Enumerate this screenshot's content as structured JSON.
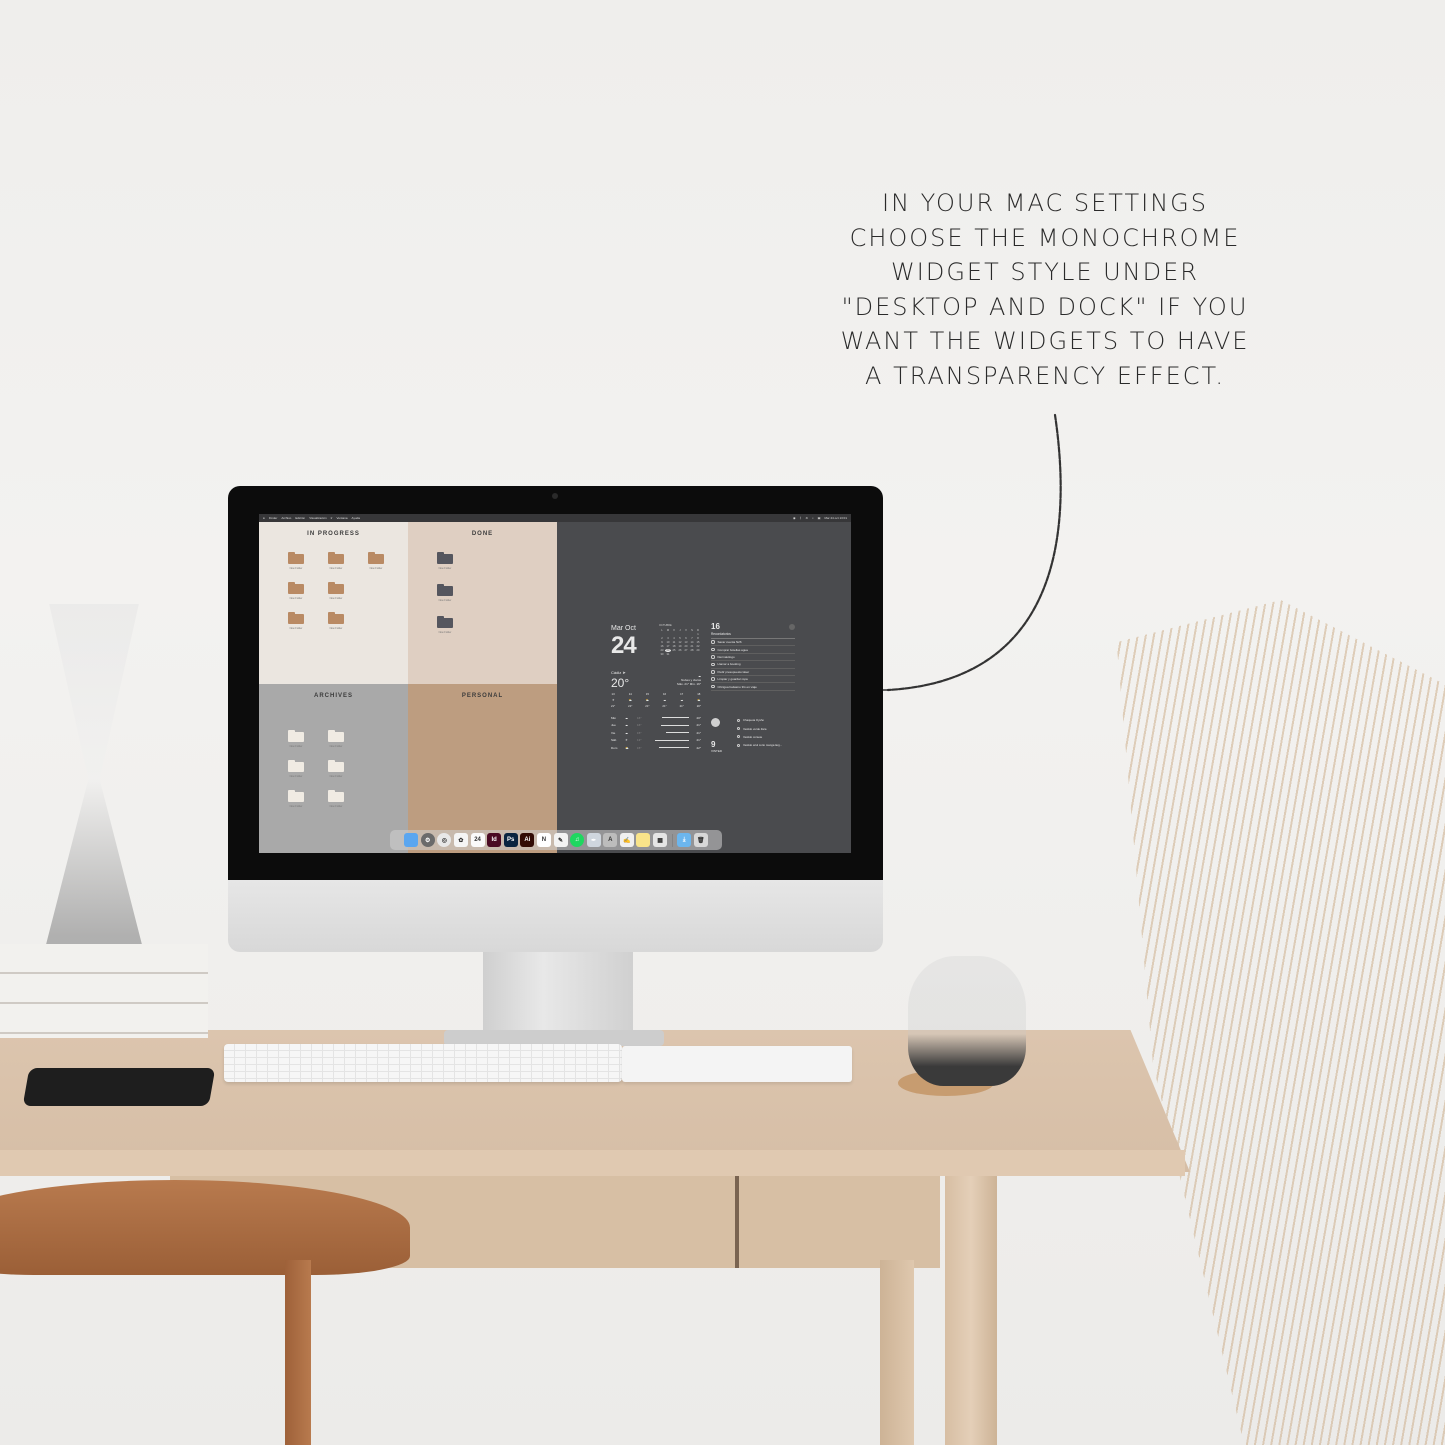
{
  "annotation": {
    "lines": [
      "In your Mac settings",
      "choose the monochrome",
      "widget style under",
      "\"Desktop and Dock\" if you",
      "want the widgets to have",
      "a transparency effect."
    ]
  },
  "menubar": {
    "left_items": [
      "Finder",
      "Archivo",
      "Edición",
      "Visualización",
      "Ir",
      "Ventana",
      "Ayuda"
    ],
    "datetime": "Mar 24 oct 13:01"
  },
  "desktop": {
    "quadrants": [
      {
        "title": "IN PROGRESS",
        "folder_style": "tan",
        "folders": [
          "New Folder",
          "New Folder",
          "New Folder",
          "New Folder",
          "New Folder",
          "New Folder",
          "New Folder"
        ]
      },
      {
        "title": "DONE",
        "folder_style": "dark",
        "folders": [
          "New Folder",
          "New Folder",
          "New Folder"
        ]
      },
      {
        "title": "ARCHIVES",
        "folder_style": "cream",
        "folders": [
          "New Folder",
          "New Folder",
          "New Folder",
          "New Folder",
          "New Folder",
          "New Folder"
        ]
      },
      {
        "title": "PERSONAL",
        "folder_style": "none",
        "folders": []
      }
    ]
  },
  "widgets": {
    "date": {
      "weekday_month": "Mar Oct",
      "day": "24"
    },
    "calendar": {
      "month": "OCTUBRE",
      "weekday_headers": [
        "L",
        "M",
        "X",
        "J",
        "V",
        "S",
        "D"
      ],
      "days": [
        "",
        "",
        "",
        "",
        "",
        "",
        "1",
        "2",
        "3",
        "4",
        "5",
        "6",
        "7",
        "8",
        "9",
        "10",
        "11",
        "12",
        "13",
        "14",
        "15",
        "16",
        "17",
        "18",
        "19",
        "20",
        "21",
        "22",
        "23",
        "24",
        "25",
        "26",
        "27",
        "28",
        "29",
        "30",
        "31"
      ],
      "today": "24"
    },
    "weather": {
      "location": "Cádiz",
      "temp": "20°",
      "condition": "Nubes y claros",
      "hi_lo": "Máx. 21° Mín. 16°",
      "hourly": [
        {
          "hour": "13",
          "icon": "sun-icon",
          "temp": "21°"
        },
        {
          "hour": "14",
          "icon": "partly-cloudy-icon",
          "temp": "21°"
        },
        {
          "hour": "15",
          "icon": "partly-cloudy-icon",
          "temp": "21°"
        },
        {
          "hour": "16",
          "icon": "cloud-icon",
          "temp": "21°"
        },
        {
          "hour": "17",
          "icon": "cloud-icon",
          "temp": "21°"
        },
        {
          "hour": "18",
          "icon": "partly-cloudy-icon",
          "temp": "20°"
        }
      ],
      "daily": [
        {
          "day": "Mié",
          "icon": "cloud-icon",
          "low": "16°",
          "high": "20°",
          "range_pct": 70
        },
        {
          "day": "Jue",
          "icon": "cloud-icon",
          "low": "16°",
          "high": "21°",
          "range_pct": 75
        },
        {
          "day": "Vie",
          "icon": "cloud-icon",
          "low": "15°",
          "high": "21°",
          "range_pct": 60
        },
        {
          "day": "Sáb",
          "icon": "sun-icon",
          "low": "13°",
          "high": "21°",
          "range_pct": 90
        },
        {
          "day": "Dom",
          "icon": "partly-cloudy-icon",
          "low": "15°",
          "high": "22°",
          "range_pct": 80
        }
      ]
    },
    "reminders": {
      "count": "16",
      "title": "Recordatorios",
      "items": [
        "Sacar cuenta N26",
        "Comprar botellas agua",
        "Dermatólogo",
        "Llamar a booking",
        "Pedir presupuesto láser",
        "Limpiar y guardar ropa",
        "Chirigua balsamo 3G en viaje"
      ]
    },
    "shopping": {
      "count": "9",
      "label": "VINTED",
      "items": [
        "Chaqueta Oysho",
        "Vestido verde Zara",
        "Vestido corsete",
        "Vestido azul corto manga larg..."
      ]
    }
  },
  "dock": {
    "apps": [
      {
        "name": "finder",
        "label": "",
        "color": "#5aa6f0"
      },
      {
        "name": "system-settings",
        "label": "⚙",
        "color": "#6b6b6b"
      },
      {
        "name": "chrome",
        "label": "◎",
        "color": "#e8e8e8"
      },
      {
        "name": "photos",
        "label": "✿",
        "color": "#f5f5f5"
      },
      {
        "name": "calendar",
        "label": "24",
        "color": "#fafafa"
      },
      {
        "name": "indesign",
        "label": "Id",
        "color": "#4a0a23"
      },
      {
        "name": "photoshop",
        "label": "Ps",
        "color": "#0a2540"
      },
      {
        "name": "illustrator",
        "label": "Ai",
        "color": "#320c05"
      },
      {
        "name": "notion",
        "label": "N",
        "color": "#ffffff"
      },
      {
        "name": "freeform",
        "label": "✎",
        "color": "#f3f3f3"
      },
      {
        "name": "spotify",
        "label": "♫",
        "color": "#1ed760"
      },
      {
        "name": "script-editor",
        "label": "✒",
        "color": "#cfd6de"
      },
      {
        "name": "font-book",
        "label": "A",
        "color": "#bcbcbc"
      },
      {
        "name": "textedit",
        "label": "✍",
        "color": "#f0f0f0"
      },
      {
        "name": "notes",
        "label": "",
        "color": "#f9e48a"
      },
      {
        "name": "launchpad",
        "label": "▦",
        "color": "#e5e5e5"
      }
    ],
    "right": [
      {
        "name": "downloads",
        "label": "⤓",
        "color": "#6cb6ee"
      },
      {
        "name": "trash",
        "label": "🗑",
        "color": "#d8d8d8"
      }
    ]
  }
}
